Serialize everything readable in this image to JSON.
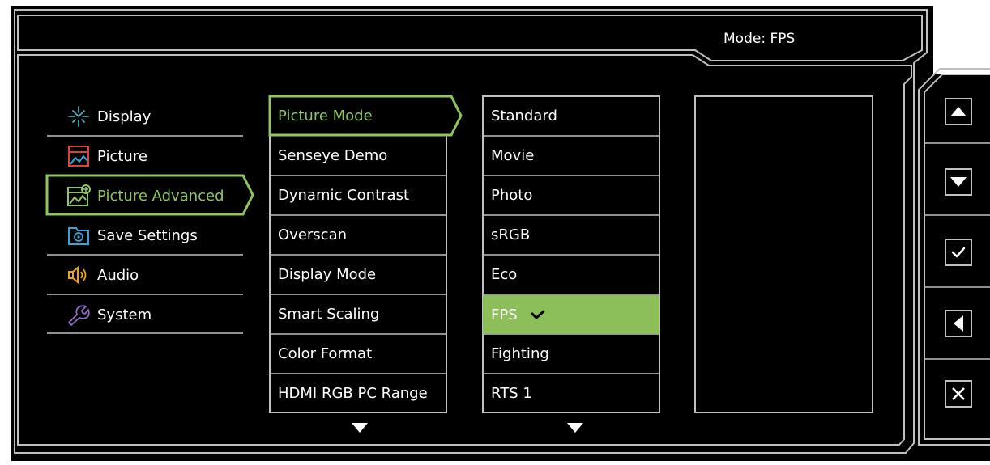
{
  "header": {
    "mode_label": "Mode: FPS"
  },
  "categories": [
    {
      "label": "Display",
      "icon": "display-icon",
      "color": "#4fc3c8"
    },
    {
      "label": "Picture",
      "icon": "picture-icon",
      "color": "#e0403a"
    },
    {
      "label": "Picture Advanced",
      "icon": "picture-advanced-icon",
      "color": "#8fc55e",
      "active": true
    },
    {
      "label": "Save Settings",
      "icon": "save-settings-icon",
      "color": "#2fa6dc"
    },
    {
      "label": "Audio",
      "icon": "audio-icon",
      "color": "#f0a400"
    },
    {
      "label": "System",
      "icon": "system-icon",
      "color": "#8f6fc3"
    }
  ],
  "submenu": [
    {
      "label": "Picture Mode",
      "active": true
    },
    {
      "label": "Senseye Demo"
    },
    {
      "label": "Dynamic Contrast"
    },
    {
      "label": "Overscan"
    },
    {
      "label": "Display Mode"
    },
    {
      "label": "Smart Scaling"
    },
    {
      "label": "Color Format"
    },
    {
      "label": "HDMI RGB PC Range"
    }
  ],
  "options": [
    {
      "label": "Standard"
    },
    {
      "label": "Movie"
    },
    {
      "label": "Photo"
    },
    {
      "label": "sRGB"
    },
    {
      "label": "Eco"
    },
    {
      "label": "FPS",
      "selected": true
    },
    {
      "label": "Fighting"
    },
    {
      "label": "RTS 1"
    }
  ],
  "side_buttons": [
    {
      "name": "up-button",
      "icon": "triangle-up-icon"
    },
    {
      "name": "down-button",
      "icon": "triangle-down-icon"
    },
    {
      "name": "confirm-button",
      "icon": "checkmark-icon"
    },
    {
      "name": "back-button",
      "icon": "triangle-left-icon"
    },
    {
      "name": "close-button",
      "icon": "close-icon"
    }
  ],
  "colors": {
    "accent_green": "#8fc55e",
    "highlight_green": "#8cbf5a",
    "frame_line": "#bfbfbf",
    "background": "#000000"
  }
}
